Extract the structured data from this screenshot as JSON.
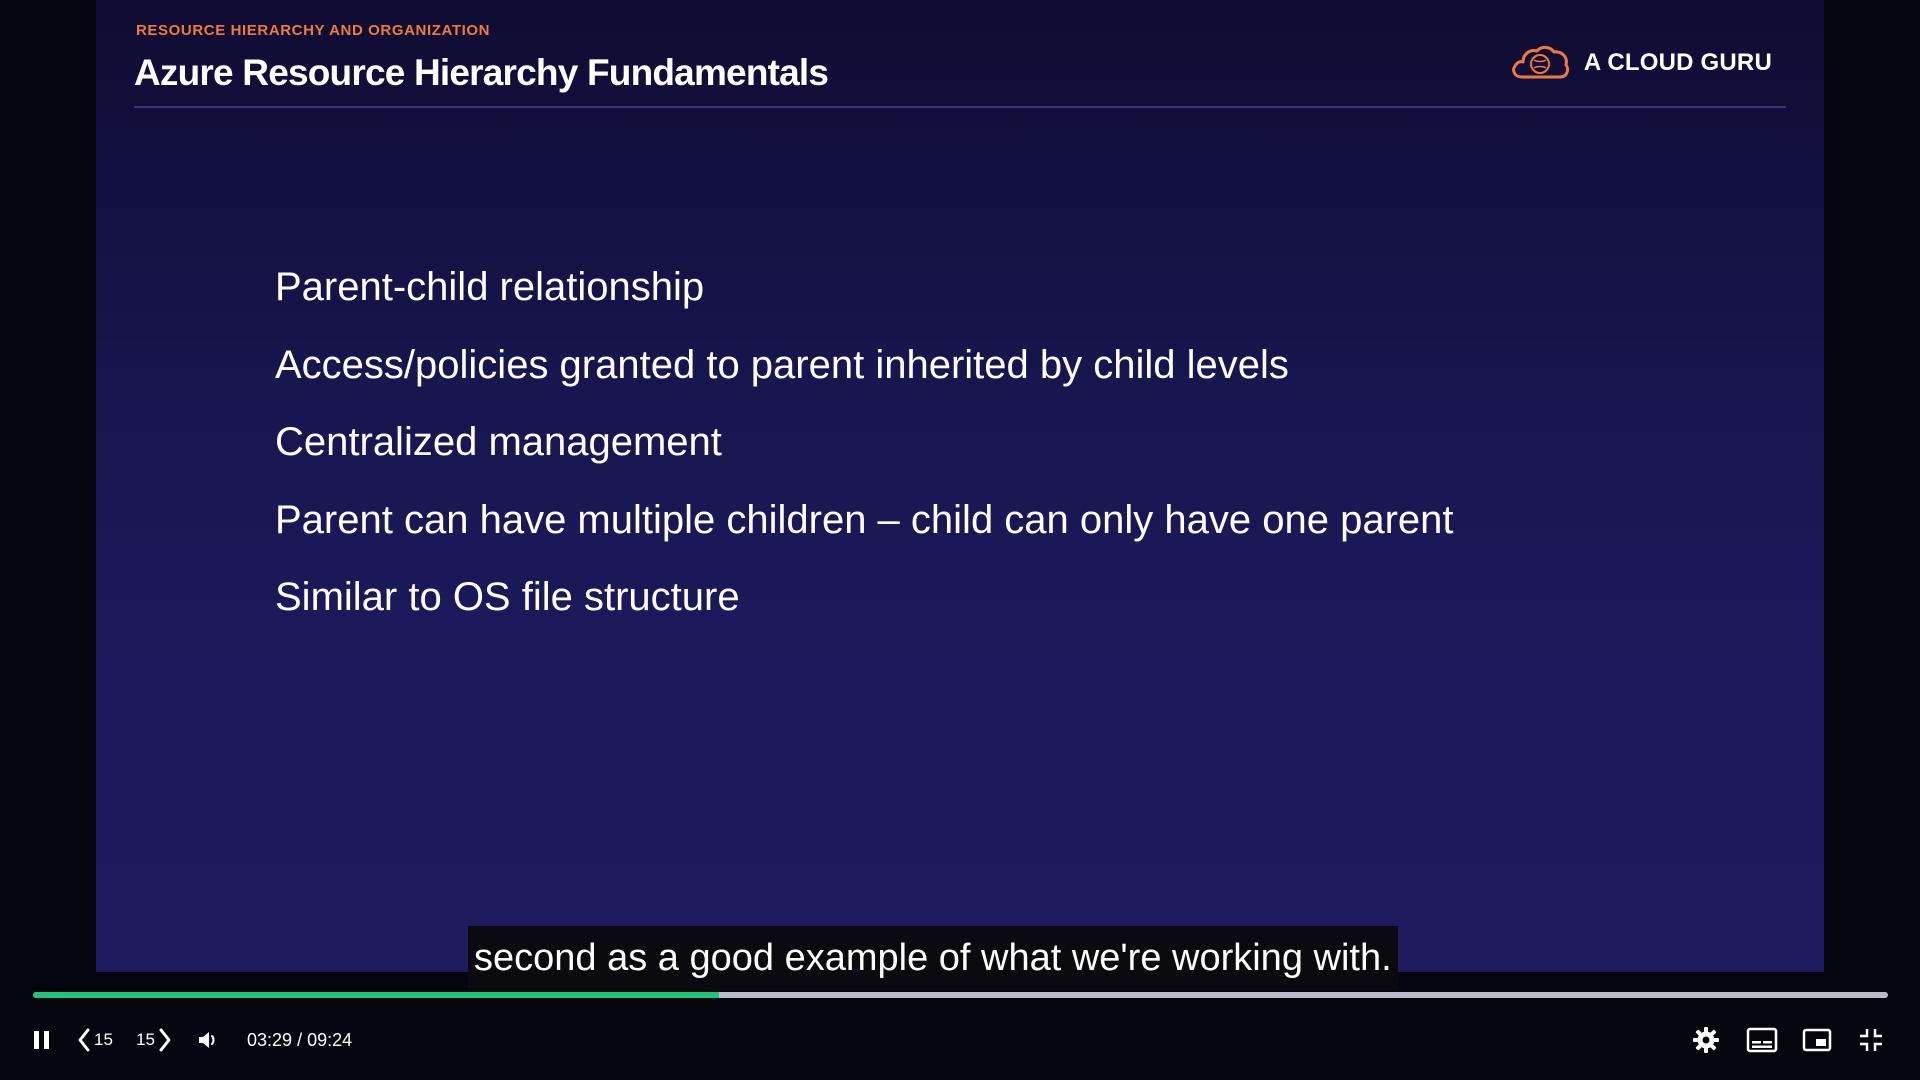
{
  "slide": {
    "eyebrow": "RESOURCE HIERARCHY AND ORGANIZATION",
    "title": "Azure Resource Hierarchy Fundamentals",
    "brand": "A CLOUD GURU",
    "bullets": [
      "Parent-child relationship",
      "Access/policies granted to parent inherited by child levels",
      "Centralized management",
      "Parent can have multiple children – child can only have one parent",
      "Similar to OS file structure"
    ]
  },
  "caption": "second as a good example of what we're working with.",
  "player": {
    "progress_fraction": 0.37,
    "back_skip_label": "15",
    "forward_skip_label": "15",
    "current_time": "03:29",
    "duration": "09:24",
    "time_separator": "/"
  },
  "icons": {
    "play_state": "pause-icon",
    "back": "chevron-left-icon",
    "forward": "chevron-right-icon",
    "volume": "volume-icon",
    "settings": "gear-icon",
    "captions": "subtitles-icon",
    "pip": "picture-in-picture-icon",
    "fullscreen": "exit-fullscreen-icon"
  },
  "colors": {
    "accent_orange": "#f07a3a",
    "progress_green": "#20c77a",
    "slide_bg": "#1c1a5c"
  }
}
